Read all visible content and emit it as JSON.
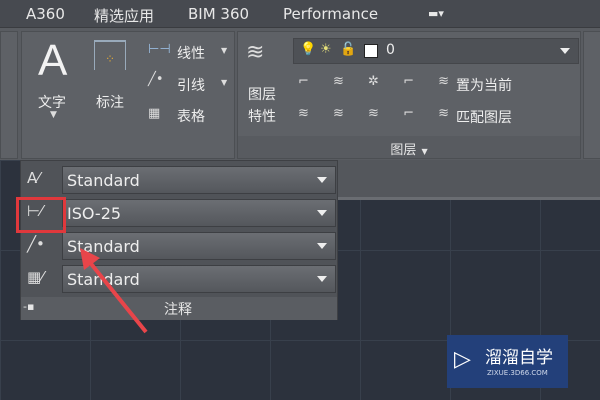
{
  "tabs": [
    "A360",
    "精选应用",
    "BIM 360",
    "Performance"
  ],
  "annotation_panel": {
    "text": "文字",
    "dimension": "标注",
    "linear": "线性",
    "leader": "引线",
    "table": "表格"
  },
  "layers_panel": {
    "properties": "图层\n特性",
    "properties_line1": "图层",
    "properties_line2": "特性",
    "current_layer": "0",
    "make_current": "置为当前",
    "match_layer": "匹配图层",
    "title": "图层"
  },
  "annotation_dropdown": {
    "rows": [
      {
        "icon": "text-style-icon",
        "value": "Standard"
      },
      {
        "icon": "dimension-style-icon",
        "value": "ISO-25"
      },
      {
        "icon": "multileader-style-icon",
        "value": "Standard"
      },
      {
        "icon": "table-style-icon",
        "value": "Standard"
      }
    ],
    "footer": "注释"
  },
  "watermark": {
    "name": "溜溜自学",
    "url": "ZIXUE.3D66.COM"
  },
  "colors": {
    "highlight": "#e0383c",
    "watermark_bg": "#23407a"
  }
}
